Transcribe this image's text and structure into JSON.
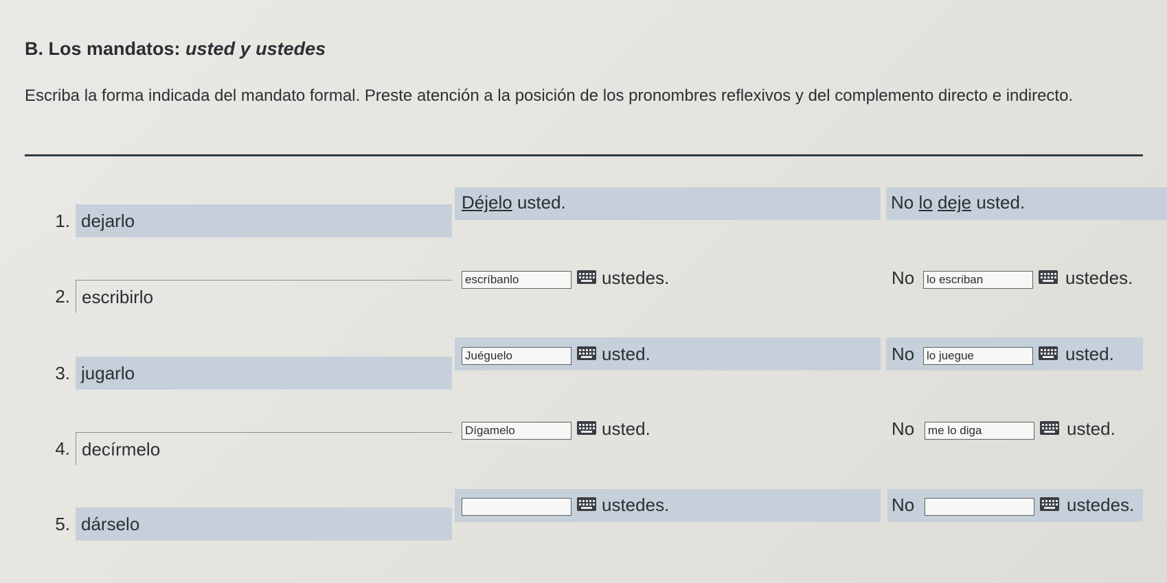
{
  "section": {
    "label": "B. Los mandatos:",
    "label_italic": "usted y ustedes",
    "instructions": "Escriba la forma indicada del mandato formal. Preste atención a la posición de los pronombres reflexivos y del complemento directo e indirecto."
  },
  "example": {
    "number": "1.",
    "verb": "dejarlo",
    "affirmative_underlined": "Déjelo",
    "affirmative_subject": "usted.",
    "negative_prefix": "No",
    "negative_underlined_1": "lo",
    "negative_underlined_2": "deje",
    "negative_subject": "usted."
  },
  "items": [
    {
      "number": "2.",
      "verb": "escribirlo",
      "affirmative_value": "escríbanlo",
      "subject": "ustedes.",
      "no_label": "No",
      "negative_value": "lo escriban",
      "negative_subject": "ustedes."
    },
    {
      "number": "3.",
      "verb": "jugarlo",
      "affirmative_value": "Juéguelo",
      "subject": "usted.",
      "no_label": "No",
      "negative_value": "lo juegue",
      "negative_subject": "usted."
    },
    {
      "number": "4.",
      "verb": "decírmelo",
      "affirmative_value": "Dígamelo",
      "subject": "usted.",
      "no_label": "No",
      "negative_value": "me lo diga",
      "negative_subject": "usted."
    },
    {
      "number": "5.",
      "verb": "dárselo",
      "affirmative_value": "",
      "subject": "ustedes.",
      "no_label": "No",
      "negative_value": "",
      "negative_subject": "ustedes."
    }
  ],
  "icons": {
    "keyboard": "keyboard-icon"
  },
  "colors": {
    "row_band": "#c6d0da",
    "rule": "#2e3a44",
    "text": "#2c2e33"
  }
}
